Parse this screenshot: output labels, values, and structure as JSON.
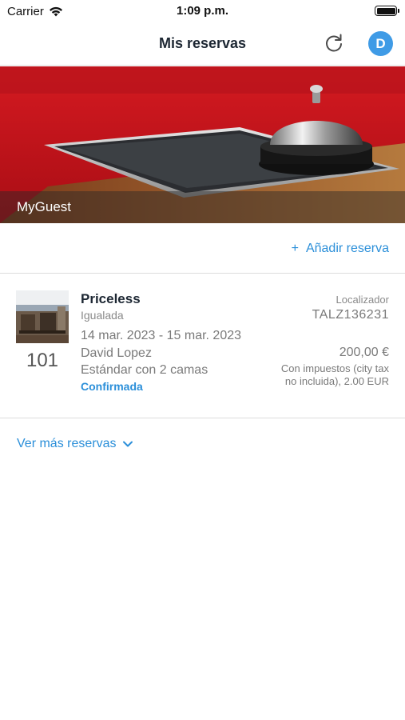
{
  "status_bar": {
    "carrier": "Carrier",
    "time": "1:09 p.m."
  },
  "nav": {
    "title": "Mis reservas",
    "avatar_initial": "D",
    "refresh_icon": "refresh-icon"
  },
  "hero": {
    "caption": "MyGuest"
  },
  "actions": {
    "add_reservation": "Añadir reserva",
    "add_icon": "+"
  },
  "reservation": {
    "hotel_name": "Priceless",
    "city": "Igualada",
    "dates": "14 mar. 2023 - 15 mar. 2023",
    "guest": "David Lopez",
    "room_type": "Estándar con 2 camas",
    "status": "Confirmada",
    "room_number": "101",
    "locator_label": "Localizador",
    "locator": "TALZ136231",
    "price": "200,00 €",
    "tax_note": "Con impuestos (city tax no incluida), 2.00 EUR"
  },
  "footer": {
    "more_reservations": "Ver más reservas"
  },
  "colors": {
    "accent": "#2b8fd9",
    "avatar": "#3f9be6",
    "hero_red": "#c5141c"
  }
}
